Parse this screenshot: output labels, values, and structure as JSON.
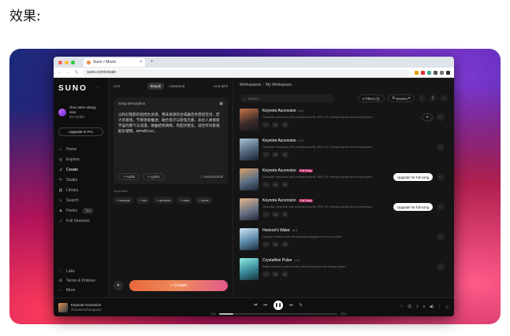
{
  "heading": "效果:",
  "browser": {
    "tab_title": "Suno • Music",
    "tab_close": "×",
    "new_tab": "+",
    "url": "suno.com/create",
    "ext_colors": [
      "#e3a008",
      "#d33",
      "#4a8",
      "#555",
      "#777",
      "#333"
    ]
  },
  "sidebar": {
    "logo": "SUNO",
    "user_name": "zhou Wen shang xiao",
    "user_credits": "50 credits",
    "upgrade": "Upgrade to Pro",
    "items": [
      {
        "icon": "⌂",
        "label": "Home"
      },
      {
        "icon": "◎",
        "label": "Explore"
      },
      {
        "icon": "♫",
        "label": "Create"
      },
      {
        "icon": "✎",
        "label": "Studio"
      },
      {
        "icon": "▤",
        "label": "Library"
      },
      {
        "icon": "⌕",
        "label": "Search"
      },
      {
        "icon": "◈",
        "label": "Hooks",
        "badge": "Beta"
      },
      {
        "icon": "♪",
        "label": "Full Sessions"
      }
    ],
    "bottom": [
      {
        "icon": "♡",
        "label": "Labs"
      },
      {
        "icon": "⚙",
        "label": "Terms & Policies"
      },
      {
        "icon": "⋯",
        "label": "More"
      }
    ]
  },
  "create": {
    "version": "v4.5",
    "mode_simple": "Simple",
    "mode_advanced": "Advanced",
    "model": "v4.5-all",
    "description_label": "Song Description",
    "description_text": "以科幻电影的氛围为灵感，用未来感的合成器音色营造空灵、宏大的意境，节奏逐渐推进；融合电子与管弦元素，表达人类探索宇宙的勇气与浪漫。歌曲结构清晰，有起伏变化，适合作为影视配乐使用，BPM约110。",
    "audio": "+ Audio",
    "lyrics": "+ Lyrics",
    "instrumental": "Instrumental",
    "inspiration_label": "Inspiration",
    "inspirations": [
      "+ tranquil",
      "+ rich",
      "+ ambient",
      "+ calm",
      "+ lyrics"
    ],
    "create_label": "♫ Create"
  },
  "workspace": {
    "crumb_root": "Workspaces",
    "crumb_current": "My Workspace",
    "search_placeholder": "Search",
    "filters": "Filters (3)",
    "sort": "Newest",
    "songs": [
      {
        "title": "Keynote Ascension",
        "ver": "v4.5",
        "tag": "",
        "desc": "Cinematic electronic with orchestral swells, BPM 110, ethereal synths and rising tension",
        "action": "",
        "thumb": "linear-gradient(160deg,#c7764a,#3a2a2a 60%,#1a1a24)",
        "selected": true
      },
      {
        "title": "Keynote Ascension",
        "ver": "v4.5",
        "tag": "",
        "desc": "Cinematic electronic with orchestral swells, BPM 110, ethereal synths and rising tension",
        "action": "",
        "thumb": "linear-gradient(160deg,#a9c2d8,#4a5d72 60%,#1b2432)",
        "selected": false
      },
      {
        "title": "Keynote Ascension",
        "ver": "",
        "tag": "Full Song",
        "desc": "Cinematic electronic with orchestral swells, BPM 110, ethereal synths and rising tension",
        "action": "Upgrade for full song",
        "thumb": "linear-gradient(160deg,#d9a06b,#5a6f86 55%,#1c2533)",
        "selected": false
      },
      {
        "title": "Keynote Ascension",
        "ver": "",
        "tag": "Full Song",
        "desc": "Cinematic electronic with orchestral swells, BPM 110, ethereal synths and rising tension",
        "action": "Upgrade for full song",
        "thumb": "linear-gradient(160deg,#e7b68a,#6b7486 55%,#20283a)",
        "selected": false
      },
      {
        "title": "Horizon's Wake",
        "ver": "v4.5",
        "tag": "",
        "desc": "Dreamy ambient pads with glowing arpeggios and a slow pulse",
        "action": "",
        "thumb": "linear-gradient(160deg,#cfe8f6,#5b88a8 55%,#1a2a3a)",
        "selected": false
      },
      {
        "title": "Crystalline Pulse",
        "ver": "v4.5",
        "tag": "",
        "desc": "Bright electronic textures with shimmering bells and driving rhythm",
        "action": "",
        "thumb": "linear-gradient(160deg,#8ef0e0,#3a8a9a 55%,#16303a)",
        "selected": false
      }
    ]
  },
  "player": {
    "title": "Keynote Ascension",
    "artist": "zhouwenshangxiao",
    "time_current": "0:21",
    "time_total": "2:54",
    "progress": 0.12
  }
}
